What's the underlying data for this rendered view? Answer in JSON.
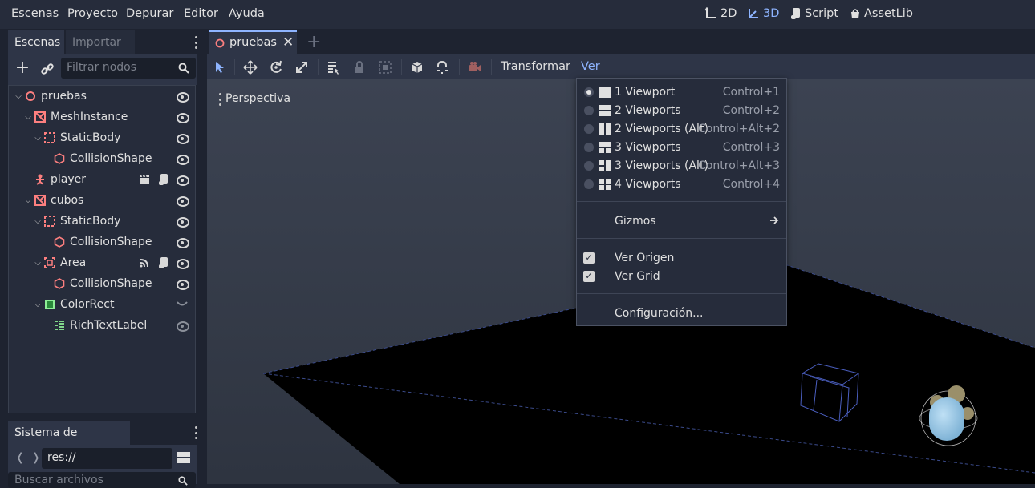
{
  "menubar": {
    "items": [
      "Escenas",
      "Proyecto",
      "Depurar",
      "Editor",
      "Ayuda"
    ],
    "modes": [
      "2D",
      "3D",
      "Script",
      "AssetLib"
    ],
    "active_mode": "3D"
  },
  "scene_dock": {
    "tabs": [
      "Escenas",
      "Importar"
    ],
    "filter_placeholder": "Filtrar nodos",
    "nodes": [
      {
        "label": "pruebas",
        "icon": "node3d-circle-icon"
      },
      {
        "label": "MeshInstance",
        "icon": "mesh-instance-icon"
      },
      {
        "label": "StaticBody",
        "icon": "static-body-icon"
      },
      {
        "label": "CollisionShape",
        "icon": "collision-shape-icon"
      },
      {
        "label": "player",
        "icon": "kinematic-body-icon"
      },
      {
        "label": "cubos",
        "icon": "mesh-instance-icon"
      },
      {
        "label": "StaticBody",
        "icon": "static-body-icon"
      },
      {
        "label": "CollisionShape",
        "icon": "collision-shape-icon"
      },
      {
        "label": "Area",
        "icon": "area-icon"
      },
      {
        "label": "CollisionShape",
        "icon": "collision-shape-icon"
      },
      {
        "label": "ColorRect",
        "icon": "color-rect-icon"
      },
      {
        "label": "RichTextLabel",
        "icon": "rich-text-label-icon"
      }
    ]
  },
  "filesystem_dock": {
    "tab": "Sistema de Archivos",
    "path": "res://",
    "search_placeholder": "Buscar archivos"
  },
  "editor": {
    "scene_tab": "pruebas",
    "toolbar": {
      "transform_menu": "Transformar",
      "view_menu": "Ver"
    },
    "viewport_label": "Perspectiva"
  },
  "view_menu": {
    "viewports": [
      {
        "label": "1 Viewport",
        "shortcut": "Control+1",
        "selected": true
      },
      {
        "label": "2 Viewports",
        "shortcut": "Control+2",
        "selected": false
      },
      {
        "label": "2 Viewports (Alt)",
        "shortcut": "Control+Alt+2",
        "selected": false
      },
      {
        "label": "3 Viewports",
        "shortcut": "Control+3",
        "selected": false
      },
      {
        "label": "3 Viewports (Alt)",
        "shortcut": "Control+Alt+3",
        "selected": false
      },
      {
        "label": "4 Viewports",
        "shortcut": "Control+4",
        "selected": false
      }
    ],
    "gizmos": "Gizmos",
    "toggles": [
      {
        "label": "Ver Origen",
        "checked": true
      },
      {
        "label": "Ver Grid",
        "checked": true
      }
    ],
    "settings": "Configuración..."
  },
  "colors": {
    "accent": "#8eb4ff",
    "node_red": "#fc7f7f",
    "node_green": "#8eef97"
  }
}
